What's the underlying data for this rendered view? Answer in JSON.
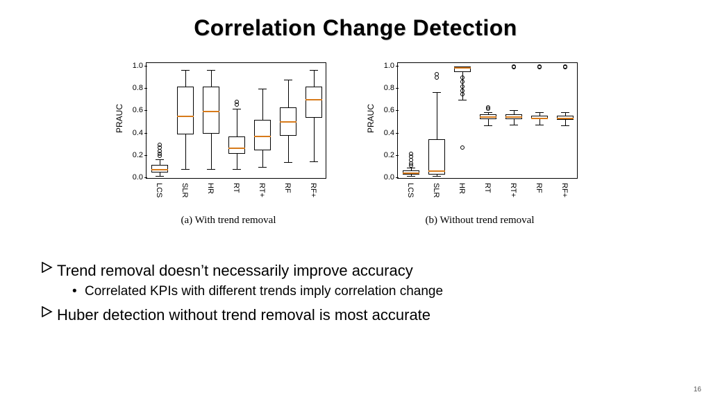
{
  "title": "Correlation Change Detection",
  "page_number": "16",
  "bullets": {
    "b1": "Trend removal doesn’t necessarily improve accuracy",
    "b1_sub": "Correlated KPIs with different trends imply correlation change",
    "b2": "Huber detection without trend removal is most accurate"
  },
  "axis": {
    "ylabel": "PRAUC",
    "yticks": [
      "0.0",
      "0.2",
      "0.4",
      "0.6",
      "0.8",
      "1.0"
    ]
  },
  "subcaptions": {
    "a": "(a) With trend removal",
    "b": "(b) Without trend removal"
  },
  "chart_data": [
    {
      "type": "box",
      "subplot": "a",
      "title": "With trend removal",
      "ylabel": "PRAUC",
      "ylim": [
        0.0,
        1.03
      ],
      "categories": [
        "LCS",
        "SLR",
        "HR",
        "RT",
        "RT+",
        "RF",
        "RF+"
      ],
      "boxes": [
        {
          "name": "LCS",
          "whisker_low": 0.02,
          "q1": 0.05,
          "median": 0.08,
          "q3": 0.12,
          "whisker_high": 0.17,
          "outliers": [
            0.2,
            0.22,
            0.24,
            0.27,
            0.3
          ]
        },
        {
          "name": "SLR",
          "whisker_low": 0.08,
          "q1": 0.39,
          "median": 0.56,
          "q3": 0.82,
          "whisker_high": 0.97,
          "outliers": []
        },
        {
          "name": "HR",
          "whisker_low": 0.08,
          "q1": 0.4,
          "median": 0.6,
          "q3": 0.82,
          "whisker_high": 0.97,
          "outliers": []
        },
        {
          "name": "RT",
          "whisker_low": 0.08,
          "q1": 0.22,
          "median": 0.27,
          "q3": 0.37,
          "whisker_high": 0.62,
          "outliers": [
            0.66,
            0.68
          ]
        },
        {
          "name": "RT+",
          "whisker_low": 0.1,
          "q1": 0.25,
          "median": 0.38,
          "q3": 0.52,
          "whisker_high": 0.8,
          "outliers": []
        },
        {
          "name": "RF",
          "whisker_low": 0.14,
          "q1": 0.38,
          "median": 0.51,
          "q3": 0.63,
          "whisker_high": 0.88,
          "outliers": []
        },
        {
          "name": "RF+",
          "whisker_low": 0.15,
          "q1": 0.54,
          "median": 0.71,
          "q3": 0.82,
          "whisker_high": 0.97,
          "outliers": []
        }
      ]
    },
    {
      "type": "box",
      "subplot": "b",
      "title": "Without trend removal",
      "ylabel": "PRAUC",
      "ylim": [
        0.0,
        1.03
      ],
      "categories": [
        "LCS",
        "SLR",
        "HR",
        "RT",
        "RT+",
        "RF",
        "RF+"
      ],
      "boxes": [
        {
          "name": "LCS",
          "whisker_low": 0.02,
          "q1": 0.03,
          "median": 0.05,
          "q3": 0.07,
          "whisker_high": 0.09,
          "outliers": [
            0.11,
            0.13,
            0.16,
            0.19,
            0.22
          ]
        },
        {
          "name": "SLR",
          "whisker_low": 0.02,
          "q1": 0.03,
          "median": 0.07,
          "q3": 0.35,
          "whisker_high": 0.77,
          "outliers": [
            0.9,
            0.93
          ]
        },
        {
          "name": "HR",
          "whisker_low": 0.7,
          "q1": 0.95,
          "median": 0.99,
          "q3": 1.0,
          "whisker_high": 1.0,
          "outliers": [
            0.27,
            0.75,
            0.78,
            0.82,
            0.86,
            0.9
          ]
        },
        {
          "name": "RT",
          "whisker_low": 0.47,
          "q1": 0.53,
          "median": 0.55,
          "q3": 0.57,
          "whisker_high": 0.59,
          "outliers": [
            0.62,
            0.63
          ]
        },
        {
          "name": "RT+",
          "whisker_low": 0.48,
          "q1": 0.53,
          "median": 0.55,
          "q3": 0.57,
          "whisker_high": 0.61,
          "outliers": [
            0.99,
            1.0
          ]
        },
        {
          "name": "RF",
          "whisker_low": 0.48,
          "q1": 0.53,
          "median": 0.54,
          "q3": 0.56,
          "whisker_high": 0.59,
          "outliers": [
            0.99,
            1.0
          ]
        },
        {
          "name": "RF+",
          "whisker_low": 0.47,
          "q1": 0.52,
          "median": 0.54,
          "q3": 0.56,
          "whisker_high": 0.59,
          "outliers": [
            0.99,
            1.0
          ]
        }
      ]
    }
  ]
}
